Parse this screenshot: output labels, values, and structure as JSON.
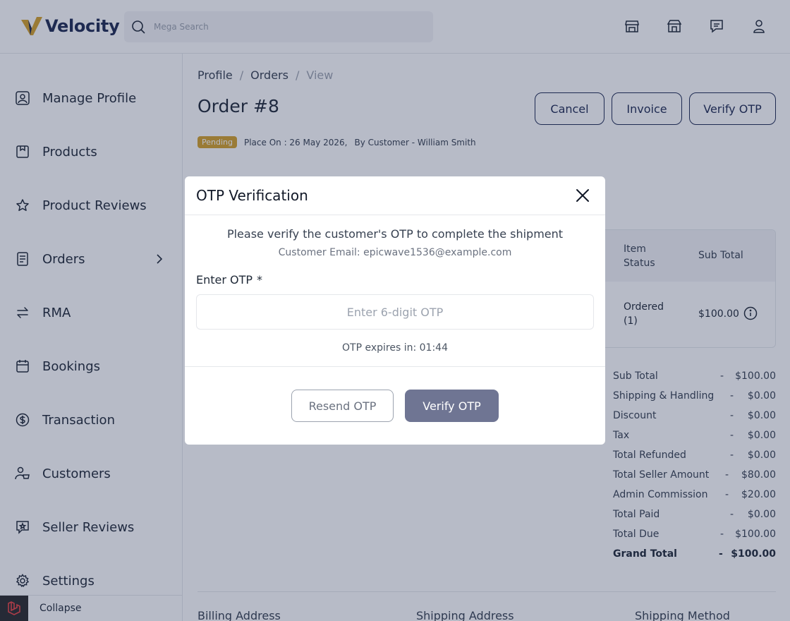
{
  "header": {
    "brand": "Velocity",
    "search_placeholder": "Mega Search",
    "icons": [
      "store-icon",
      "shop-icon",
      "chat-icon",
      "user-icon"
    ]
  },
  "sidebar": {
    "items": [
      {
        "label": "Manage Profile",
        "icon": "profile-icon"
      },
      {
        "label": "Products",
        "icon": "box-icon"
      },
      {
        "label": "Product Reviews",
        "icon": "star-icon"
      },
      {
        "label": "Orders",
        "icon": "document-icon"
      },
      {
        "label": "RMA",
        "icon": "swap-icon"
      },
      {
        "label": "Bookings",
        "icon": "calendar-icon"
      },
      {
        "label": "Transaction",
        "icon": "dollar-icon"
      },
      {
        "label": "Customers",
        "icon": "customers-icon"
      },
      {
        "label": "Seller Reviews",
        "icon": "review-icon"
      },
      {
        "label": "Settings",
        "icon": "gear-icon"
      }
    ],
    "collapse_label": "Collapse"
  },
  "breadcrumb": {
    "profile": "Profile",
    "orders": "Orders",
    "current": "View",
    "separator": "/"
  },
  "order": {
    "title": "Order #8",
    "status": "Pending",
    "placed_on": "Place On : 26 May 2026,",
    "by_customer": "By Customer - William Smith",
    "actions": {
      "cancel": "Cancel",
      "invoice": "Invoice",
      "verify": "Verify OTP"
    }
  },
  "items_table": {
    "headers": {
      "item_status_1": "Item",
      "item_status_2": "Status",
      "sub_total": "Sub Total"
    },
    "row": {
      "status_1": "Ordered",
      "status_2": "(1)",
      "sub_total": "$100.00"
    }
  },
  "summary": [
    {
      "label": "Sub Total",
      "dash": "-",
      "value": "$100.00"
    },
    {
      "label": "Shipping & Handling",
      "dash": "-",
      "value": "$0.00"
    },
    {
      "label": "Discount",
      "dash": "-",
      "value": "$0.00"
    },
    {
      "label": "Tax",
      "dash": "-",
      "value": "$0.00"
    },
    {
      "label": "Total Refunded",
      "dash": "-",
      "value": "$0.00"
    },
    {
      "label": "Total Seller Amount",
      "dash": "-",
      "value": "$80.00"
    },
    {
      "label": "Admin Commission",
      "dash": "-",
      "value": "$20.00"
    },
    {
      "label": "Total Paid",
      "dash": "-",
      "value": "$0.00"
    },
    {
      "label": "Total Due",
      "dash": "-",
      "value": "$100.00"
    },
    {
      "label": "Grand Total",
      "dash": "-",
      "value": "$100.00"
    }
  ],
  "addresses": {
    "billing": "Billing Address",
    "shipping": "Shipping Address",
    "method": "Shipping Method"
  },
  "modal": {
    "title": "OTP Verification",
    "message": "Please verify the customer's OTP to complete the shipment",
    "email": "Customer Email: epicwave1536@example.com",
    "otp_label": "Enter OTP",
    "required_mark": "*",
    "otp_placeholder": "Enter 6-digit OTP",
    "otp_value": "",
    "expires": "OTP expires in: 01:44",
    "resend": "Resend OTP",
    "verify": "Verify OTP"
  },
  "colors": {
    "brand": "#1e2a52",
    "pending": "#d4a12a",
    "verify_button": "#6f7593",
    "logo_gold": "#d4a12a"
  }
}
